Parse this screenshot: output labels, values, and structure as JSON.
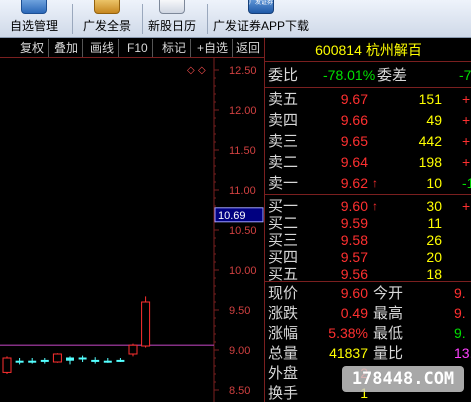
{
  "toolbar": {
    "buttons": [
      {
        "label": "自选管理",
        "icon": "watchlist-icon"
      },
      {
        "label": "广发全景",
        "icon": "panorama-icon"
      },
      {
        "label": "新股日历",
        "icon": "calendar-icon"
      },
      {
        "label": "广发证券APP下载",
        "icon": "app-download-icon",
        "icon_text": "广发证券"
      }
    ]
  },
  "chart_tabs": [
    "复权",
    "叠加",
    "画线",
    "F10",
    "标记",
    "+自选",
    "返回"
  ],
  "chart_data": {
    "type": "candlestick",
    "y_ticks": [
      12.5,
      12.0,
      11.5,
      11.0,
      10.5,
      10.0,
      9.5,
      9.0,
      8.5
    ],
    "y_tick_labels": [
      "12.50",
      "12.00",
      "11.50",
      "11.00",
      "10.50",
      "10.00",
      "9.50",
      "9.00",
      "8.50"
    ],
    "ylim": [
      8.35,
      12.65
    ],
    "cursor_price": "10.69",
    "reference_line": 9.06,
    "candles": [
      {
        "open": 8.9,
        "close": 8.72,
        "high": 8.92,
        "low": 8.7,
        "color": "red"
      },
      {
        "open": 8.86,
        "close": 8.86,
        "high": 8.9,
        "low": 8.82,
        "color": "cyan"
      },
      {
        "open": 8.86,
        "close": 8.86,
        "high": 8.9,
        "low": 8.83,
        "color": "cyan"
      },
      {
        "open": 8.87,
        "close": 8.87,
        "high": 8.9,
        "low": 8.83,
        "color": "cyan"
      },
      {
        "open": 8.85,
        "close": 8.95,
        "high": 8.96,
        "low": 8.84,
        "color": "red"
      },
      {
        "open": 8.9,
        "close": 8.86,
        "high": 8.92,
        "low": 8.82,
        "color": "cyan"
      },
      {
        "open": 8.9,
        "close": 8.9,
        "high": 8.93,
        "low": 8.85,
        "color": "cyan"
      },
      {
        "open": 8.87,
        "close": 8.87,
        "high": 8.91,
        "low": 8.83,
        "color": "cyan"
      },
      {
        "open": 8.86,
        "close": 8.86,
        "high": 8.9,
        "low": 8.84,
        "color": "cyan"
      },
      {
        "open": 8.87,
        "close": 8.87,
        "high": 8.9,
        "low": 8.85,
        "color": "cyan"
      },
      {
        "open": 8.95,
        "close": 9.06,
        "high": 9.08,
        "low": 8.92,
        "color": "red"
      },
      {
        "open": 9.05,
        "close": 9.6,
        "high": 9.67,
        "low": 9.03,
        "color": "red"
      }
    ]
  },
  "quote": {
    "code": "600814",
    "name": "杭州解百",
    "weibi_label": "委比",
    "weibi_value": "-78.01%",
    "weicha_label": "委差",
    "weicha_value": "-7",
    "sells": [
      {
        "label": "卖五",
        "price": "9.67",
        "vol": "151",
        "chg": "+"
      },
      {
        "label": "卖四",
        "price": "9.66",
        "vol": "49",
        "chg": "+"
      },
      {
        "label": "卖三",
        "price": "9.65",
        "vol": "442",
        "chg": "+"
      },
      {
        "label": "卖二",
        "price": "9.64",
        "vol": "198",
        "chg": "+"
      },
      {
        "label": "卖一",
        "price": "9.62",
        "vol": "10",
        "chg": "-1",
        "arrow": "↑"
      }
    ],
    "buys": [
      {
        "label": "买一",
        "price": "9.60",
        "vol": "30",
        "chg": "+",
        "arrow": "↑"
      },
      {
        "label": "买二",
        "price": "9.59",
        "vol": "11",
        "chg": ""
      },
      {
        "label": "买三",
        "price": "9.58",
        "vol": "26",
        "chg": ""
      },
      {
        "label": "买四",
        "price": "9.57",
        "vol": "20",
        "chg": ""
      },
      {
        "label": "买五",
        "price": "9.56",
        "vol": "18",
        "chg": ""
      }
    ],
    "stats": [
      {
        "l1": "现价",
        "v1": "9.60",
        "c1": "red",
        "l2": "今开",
        "v2": "9.",
        "c2": "red"
      },
      {
        "l1": "涨跌",
        "v1": "0.49",
        "c1": "red",
        "l2": "最高",
        "v2": "9.",
        "c2": "red"
      },
      {
        "l1": "涨幅",
        "v1": "5.38%",
        "c1": "red",
        "l2": "最低",
        "v2": "9.",
        "c2": "green"
      },
      {
        "l1": "总量",
        "v1": "41837",
        "c1": "yellow",
        "l2": "量比",
        "v2": "13.",
        "c2": "magenta"
      },
      {
        "l1": "外盘",
        "v1": "2",
        "c1": "red",
        "l2": "",
        "v2": "",
        "c2": "red"
      },
      {
        "l1": "换手",
        "v1": "1",
        "c1": "yellow",
        "l2": "",
        "v2": "",
        "c2": "yellow"
      }
    ]
  },
  "watermark": "178448.COM",
  "colors": {
    "up": "#ff3030",
    "down_cyan": "#54ffff",
    "grid": "#7a1f1f",
    "axis_text": "#d04040",
    "ref_line": "#b040b0",
    "cursor_box": "#000080"
  }
}
